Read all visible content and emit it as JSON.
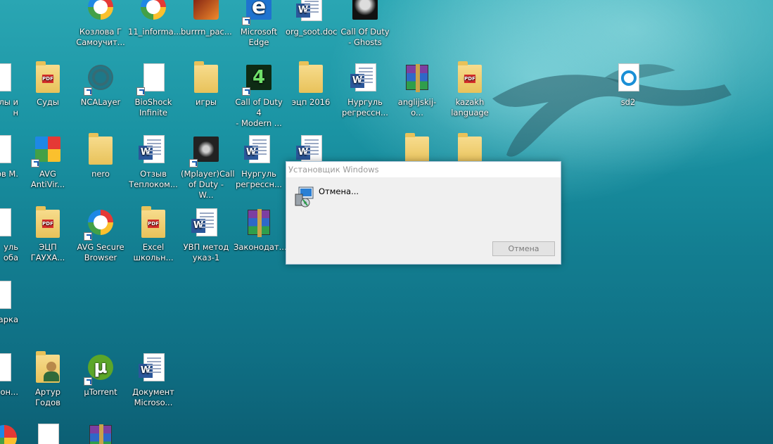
{
  "desktop_icons": [
    {
      "label": "Козлова Г\nСамоучит...",
      "kind": "avg-browser"
    },
    {
      "label": "11_informa...",
      "kind": "avg-browser"
    },
    {
      "label": "burrrn_pac...",
      "kind": "game"
    },
    {
      "label": "Microsoft\nEdge",
      "kind": "edge"
    },
    {
      "label": "org_soot.doc",
      "kind": "word"
    },
    {
      "label": "Call Of Duty\n- Ghosts",
      "kind": "game"
    },
    {
      "label": "лы и\nн",
      "kind": "doc"
    },
    {
      "label": "Суды",
      "kind": "folder-pdf"
    },
    {
      "label": "NCALayer",
      "kind": "ncalayer"
    },
    {
      "label": "BioShock\nInfinite",
      "kind": "blank"
    },
    {
      "label": "игры",
      "kind": "folder"
    },
    {
      "label": "Call of Duty 4\n- Modern ...",
      "kind": "game"
    },
    {
      "label": "эцп 2016",
      "kind": "folder"
    },
    {
      "label": "Нургуль\nрегрессн...",
      "kind": "word"
    },
    {
      "label": "anglijskij-o...",
      "kind": "winrar"
    },
    {
      "label": "kazakh\nlanguage",
      "kind": "folder-pdf"
    },
    {
      "label": "sd2",
      "kind": "sd2"
    },
    {
      "label": "ов М.",
      "kind": "doc"
    },
    {
      "label": "AVG\nAntiVir...",
      "kind": "avg"
    },
    {
      "label": "nero",
      "kind": "folder"
    },
    {
      "label": "Отзыв\nТепл­ок­ом...",
      "kind": "word"
    },
    {
      "label": "(Mplayer)Call\nof Duty - W...",
      "kind": "game"
    },
    {
      "label": "Нургуль\nрегрессн...",
      "kind": "word"
    },
    {
      "label": "уль\nоба",
      "kind": "doc"
    },
    {
      "label": "ЭЦП\nГАУХА...",
      "kind": "folder-pdf"
    },
    {
      "label": "AVG Secure\nBrowser",
      "kind": "avg-browser"
    },
    {
      "label": "Excel\nшкольн...",
      "kind": "folder-pdf"
    },
    {
      "label": "УВП метод\nуказ-1",
      "kind": "word"
    },
    {
      "label": "Законодат...",
      "kind": "winrar"
    },
    {
      "label": "арка",
      "kind": "doc"
    },
    {
      "label": "он...",
      "kind": "doc"
    },
    {
      "label": "Артур Годов",
      "kind": "user-folder"
    },
    {
      "label": "µTorrent",
      "kind": "utorrent"
    },
    {
      "label": "Документ\nMicroso...",
      "kind": "word"
    }
  ],
  "dialog": {
    "title": "Установщик Windows",
    "message": "Отмена...",
    "cancel_label": "Отмена"
  },
  "colors": {
    "desktop_water": "#1a93a3",
    "word_blue": "#2b579a",
    "dialog_bg": "#f0f0f0"
  }
}
